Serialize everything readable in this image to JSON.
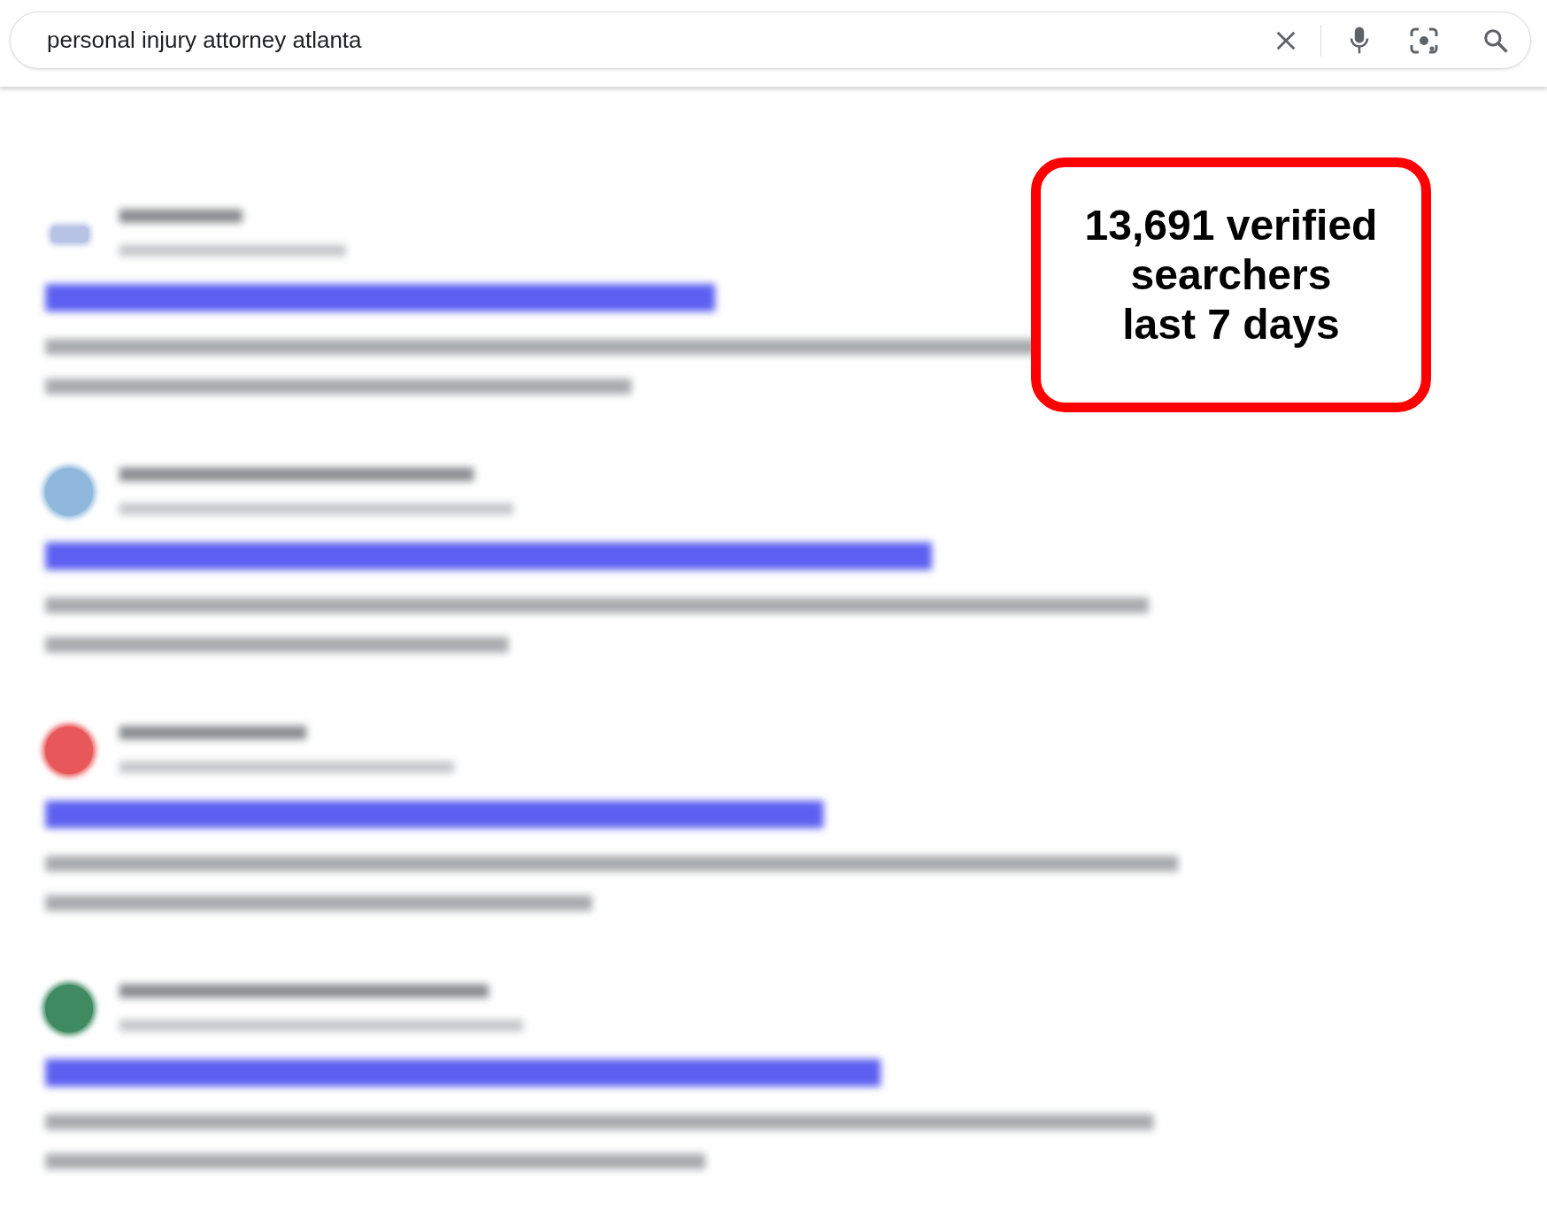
{
  "search": {
    "value": "personal injury attorney atlanta"
  },
  "results": [
    {
      "kind": "blurred",
      "color": "#b8c4e6"
    },
    {
      "kind": "blurred",
      "color": "#8fb8dc"
    },
    {
      "kind": "blurred",
      "color": "#e8585a"
    },
    {
      "kind": "blurred",
      "color": "#3f8a60"
    }
  ],
  "callout": {
    "lines": [
      "13,691 verified",
      "searchers",
      "last 7 days"
    ],
    "color": "#ff0000"
  }
}
